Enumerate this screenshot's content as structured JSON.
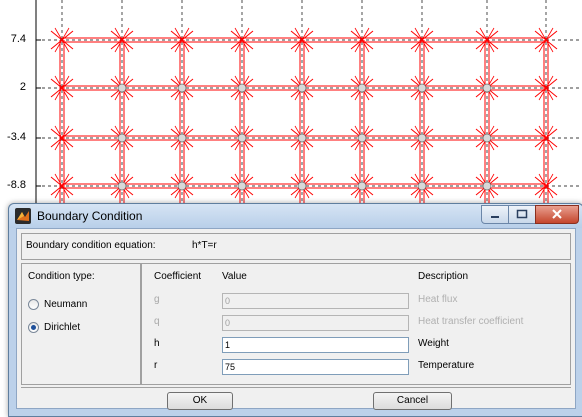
{
  "plot": {
    "y_ticks": [
      "7.4",
      "2",
      "-3.4",
      "-8.8"
    ],
    "grid_color": "#ff0000",
    "axis_color": "#000000"
  },
  "dialog": {
    "title": "Boundary Condition",
    "equation_label": "Boundary condition equation:",
    "equation_value": "h*T=r",
    "condition_type_label": "Condition type:",
    "condition_types": [
      {
        "label": "Neumann",
        "selected": false
      },
      {
        "label": "Dirichlet",
        "selected": true
      }
    ],
    "headers": {
      "coefficient": "Coefficient",
      "value": "Value",
      "description": "Description"
    },
    "rows": [
      {
        "coef": "g",
        "value": "0",
        "description": "Heat flux",
        "enabled": false
      },
      {
        "coef": "q",
        "value": "0",
        "description": "Heat transfer coefficient",
        "enabled": false
      },
      {
        "coef": "h",
        "value": "1",
        "description": "Weight",
        "enabled": true
      },
      {
        "coef": "r",
        "value": "75",
        "description": "Temperature",
        "enabled": true
      }
    ],
    "ok_label": "OK",
    "cancel_label": "Cancel"
  }
}
